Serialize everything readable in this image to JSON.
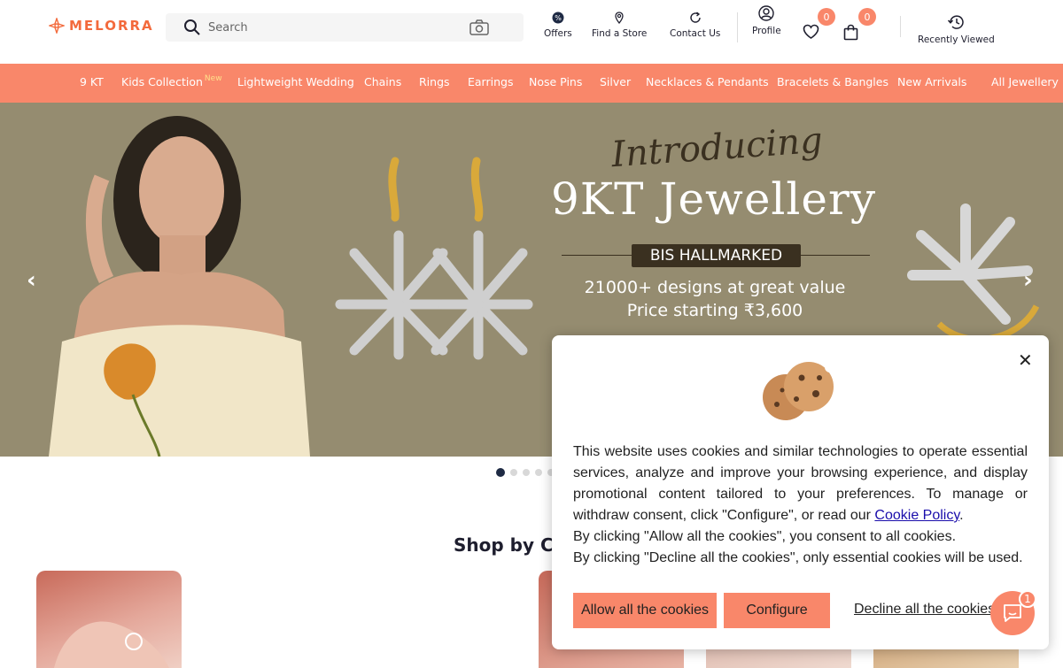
{
  "brand": {
    "name": "MELORRA",
    "accent": "#f9876a"
  },
  "search": {
    "placeholder": "Search"
  },
  "header": {
    "offers": "Offers",
    "find_store": "Find a Store",
    "contact": "Contact Us",
    "profile": "Profile",
    "wishlist_count": "0",
    "cart_count": "0",
    "recently_viewed": "Recently Viewed"
  },
  "nav": {
    "items": [
      {
        "label": "9 KT"
      },
      {
        "label": "Kids Collection",
        "badge": "New"
      },
      {
        "label": "Lightweight Wedding"
      },
      {
        "label": "Chains"
      },
      {
        "label": "Rings"
      },
      {
        "label": "Earrings"
      },
      {
        "label": "Nose Pins"
      },
      {
        "label": "Silver"
      },
      {
        "label": "Necklaces & Pendants"
      },
      {
        "label": "Bracelets & Bangles"
      },
      {
        "label": "New Arrivals"
      },
      {
        "label": "All Jewellery"
      }
    ]
  },
  "banner": {
    "intro": "Introducing",
    "headline": "9KT Jewellery",
    "badge": "BIS HALLMARKED",
    "line1": "21000+ designs at great value",
    "line2": "Price starting ₹3,600",
    "active_slide": 1,
    "slide_count": 5
  },
  "shop": {
    "title": "Shop by Cate"
  },
  "cookie": {
    "paragraph_before_link": "This website uses cookies and similar technologies to operate essential services, analyze and improve your browsing experience, and display promotional content tailored to your preferences. To manage or withdraw consent, click \"Configure\", or read our ",
    "link": "Cookie Policy",
    "paragraph_after_link": ".",
    "allow_note": "By clicking \"Allow all the cookies\", you consent to all cookies.",
    "decline_note": "By clicking \"Decline all the cookies\", only essential cookies will be used.",
    "allow_button": "Allow all the cookies",
    "configure_button": "Configure",
    "decline_button": "Decline all the cookies"
  },
  "chat": {
    "badge": "1"
  }
}
